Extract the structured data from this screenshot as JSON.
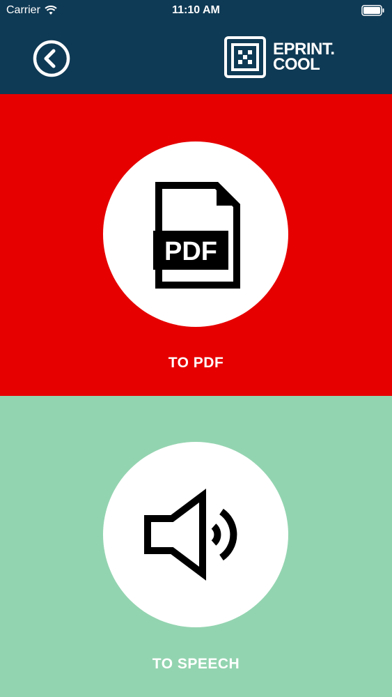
{
  "status_bar": {
    "carrier": "Carrier",
    "time": "11:10 AM"
  },
  "header": {
    "back_icon": "chevron-left-circle-icon",
    "brand": {
      "line1": "EPRINT.",
      "line2": "COOL"
    }
  },
  "options": {
    "pdf": {
      "label": "TO PDF",
      "icon_text": "PDF",
      "icon": "pdf-file-icon",
      "background": "#e60000"
    },
    "speech": {
      "label": "TO SPEECH",
      "icon": "speaker-icon",
      "background": "#93d4b0"
    }
  },
  "colors": {
    "header_bg": "#0f3a55"
  }
}
